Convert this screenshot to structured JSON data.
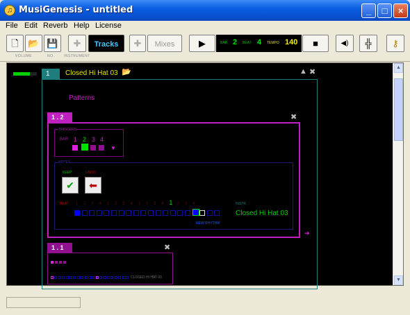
{
  "window": {
    "title": "MusiGenesis - untitled",
    "app_icon": "music-note-icon"
  },
  "menu": [
    "File",
    "Edit",
    "Reverb",
    "Help",
    "License"
  ],
  "toolbar": {
    "new_icon": "new-document-icon",
    "open_icon": "folder-icon",
    "save_icon": "floppy-icon",
    "tracks_label": "Tracks",
    "mixes_label": "Mixes",
    "labels": {
      "volume": "VOLUME",
      "no": "NO.",
      "instrument": "INSTRUMENT"
    },
    "bar_label": "BAR",
    "bar": "2",
    "beat_label": "BEAT",
    "beat": "4",
    "tempo_label": "TEMPO",
    "tempo": "140",
    "play_icon": "play-icon",
    "stop_icon": "stop-icon",
    "speaker_icon": "speaker-icon",
    "mixer_icon": "mixer-icon",
    "help_icon": "key-icon"
  },
  "track": {
    "number": "1",
    "name": "Closed Hi Hat 03",
    "volume": 0.7,
    "patterns_label": "Patterns"
  },
  "pattern_main": {
    "id": "1 . 2",
    "triggers_label": "TRIGGERS",
    "bar_label": "BAR",
    "bar_nums": [
      "1",
      "2",
      "3",
      "4"
    ],
    "notes_label": "NOTES",
    "keep_label": "KEEP",
    "undo_label": "UNDO",
    "beat_label": "BEAT",
    "beat_nums": [
      "1",
      "2",
      "3",
      "4",
      "1",
      "2",
      "3",
      "4",
      "1",
      "2",
      "3",
      "4",
      "1",
      "2",
      "3",
      "4"
    ],
    "current_beat_index": 12,
    "filled_steps": [
      0,
      12
    ],
    "instr_label": "INSTR",
    "instr_name": "Closed Hi Hat 03",
    "new_rhythm": "NEW RHYTHM"
  },
  "pattern_second": {
    "id": "1 . 1",
    "instr_name": "CLOSED HI HAT 03"
  },
  "colors": {
    "magenta": "#c020c0",
    "teal": "#1e7d7d",
    "green": "#00e000",
    "blue": "#0000ff",
    "yellow": "#e8e800"
  }
}
